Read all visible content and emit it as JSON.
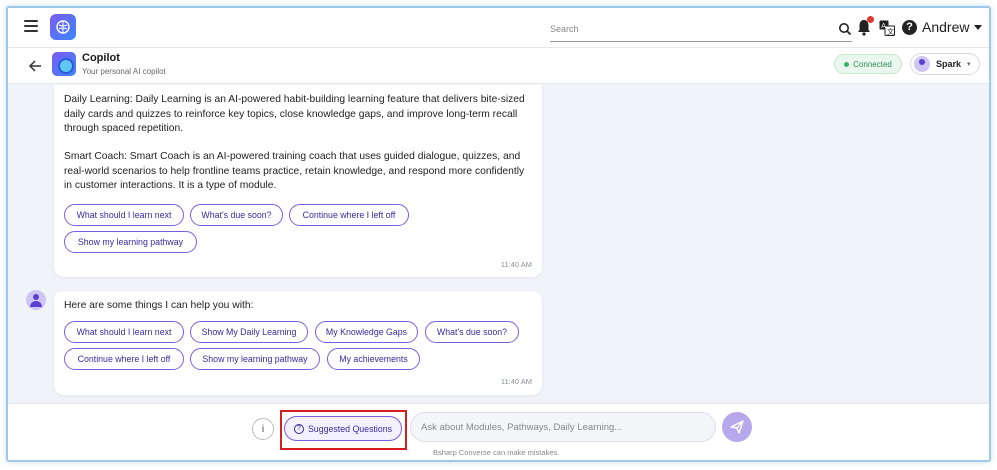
{
  "topbar": {
    "search_placeholder": "Search",
    "user_name": "Andrew"
  },
  "header": {
    "title": "Copilot",
    "subtitle": "Your personal AI copilot",
    "status": "Connected",
    "model": "Spark"
  },
  "messages": [
    {
      "paragraphs": [
        "Daily Learning: Daily Learning is an AI-powered habit-building learning feature that delivers bite-sized daily cards and quizzes to reinforce key topics, close knowledge gaps, and improve long-term recall through spaced repetition.",
        "Smart Coach: Smart Coach is an AI-powered training coach that uses guided dialogue, quizzes, and real-world scenarios to help frontline teams practice, retain knowledge, and respond more confidently in customer interactions. It is a type of module."
      ],
      "chips": [
        "What should I learn next",
        "What's due soon?",
        "Continue where I left off",
        "Show my learning pathway"
      ],
      "time": "11:40 AM"
    },
    {
      "paragraphs": [
        "Here are some things I can help you with:"
      ],
      "chips": [
        "What should I learn next",
        "Show My Daily Learning",
        "My Knowledge Gaps",
        "What's due soon?",
        "Continue where I left off",
        "Show my learning pathway",
        "My achievements"
      ],
      "time": "11:40 AM"
    }
  ],
  "composer": {
    "info_label": "i",
    "suggested_label": "Suggested Questions",
    "placeholder": "Ask about Modules, Pathways, Daily Learning...",
    "disclaimer": "Bsharp Converse can make mistakes."
  },
  "colors": {
    "accent": "#7c5ce0",
    "chip_text": "#3b2a9e",
    "status_green": "#34b36b",
    "highlight_red": "#d21f1f"
  }
}
